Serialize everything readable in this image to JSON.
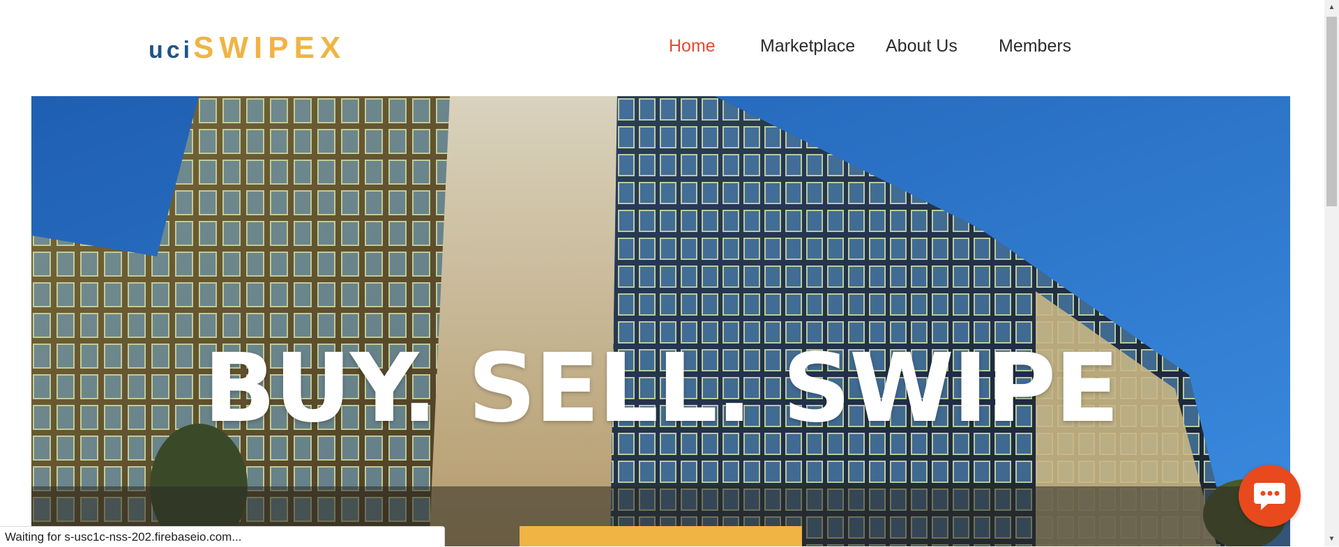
{
  "logo": {
    "part1": "uci",
    "part2": "SWIPEX"
  },
  "nav": {
    "items": [
      {
        "label": "Home",
        "active": true
      },
      {
        "label": "Marketplace",
        "active": false
      },
      {
        "label": "About Us",
        "active": false
      },
      {
        "label": "Members",
        "active": false
      }
    ]
  },
  "hero": {
    "headline": "BUY. SELL. SWIPE"
  },
  "chat": {
    "icon": "chat-bubble-icon"
  },
  "browser": {
    "status_text": "Waiting for s-usc1c-nss-202.firebaseio.com..."
  },
  "colors": {
    "logo_blue": "#1e5489",
    "logo_yellow": "#f0b444",
    "nav_active": "#e8492f",
    "chat_button": "#e8491d",
    "cta": "#f0b444"
  }
}
